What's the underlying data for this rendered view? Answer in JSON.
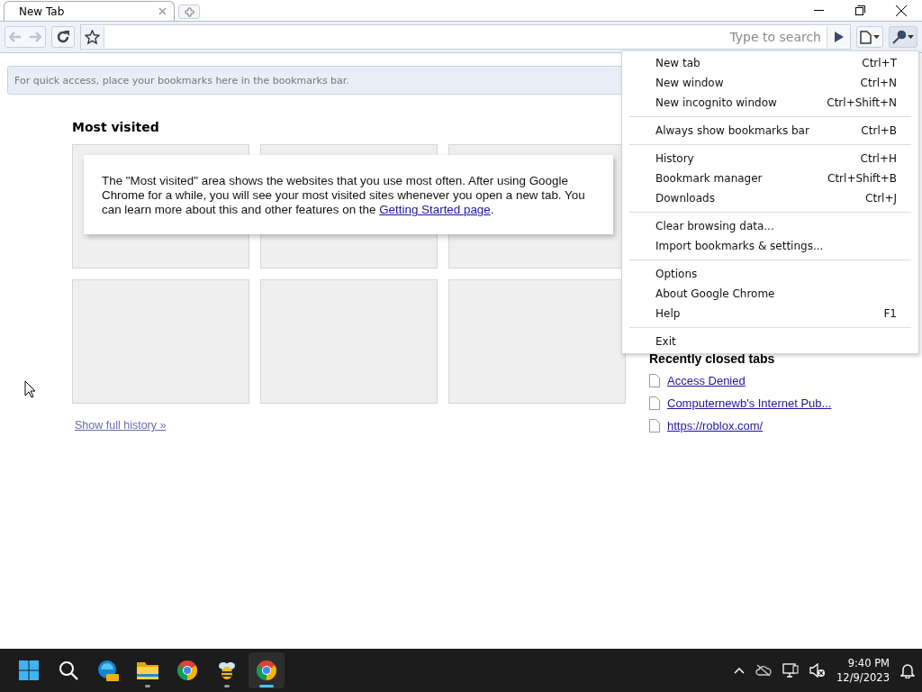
{
  "tabs": [
    {
      "title": "New Tab",
      "selected": true
    }
  ],
  "toolbar": {
    "search_placeholder": "Type to search"
  },
  "bookmarks_bar": {
    "message": "For quick access, place your bookmarks here in the bookmarks bar."
  },
  "most_visited": {
    "title": "Most visited",
    "info": "The \"Most visited\" area shows the websites that you use most often. After using Google Chrome for a while, you will see your most visited sites whenever you open a new tab. You can learn more about this and other features on the ",
    "info_link": "Getting Started page",
    "info_end": ".",
    "history_link": "Show full history »"
  },
  "recently_closed": {
    "title": "Recently closed tabs",
    "items": [
      "Access Denied",
      "Computernewb's Internet Pub...",
      "https://roblox.com/"
    ]
  },
  "menu": {
    "groups": [
      [
        {
          "label": "New tab",
          "shortcut": "Ctrl+T"
        },
        {
          "label": "New window",
          "shortcut": "Ctrl+N"
        },
        {
          "label": "New incognito window",
          "shortcut": "Ctrl+Shift+N"
        }
      ],
      [
        {
          "label": "Always show bookmarks bar",
          "shortcut": "Ctrl+B"
        }
      ],
      [
        {
          "label": "History",
          "shortcut": "Ctrl+H"
        },
        {
          "label": "Bookmark manager",
          "shortcut": "Ctrl+Shift+B"
        },
        {
          "label": "Downloads",
          "shortcut": "Ctrl+J"
        }
      ],
      [
        {
          "label": "Clear browsing data..."
        },
        {
          "label": "Import bookmarks & settings..."
        }
      ],
      [
        {
          "label": "Options"
        },
        {
          "label": "About Google Chrome"
        },
        {
          "label": "Help",
          "shortcut": "F1"
        }
      ],
      [
        {
          "label": "Exit"
        }
      ]
    ]
  },
  "taskbar": {
    "apps": [
      {
        "kind": "start",
        "running": false,
        "active": false
      },
      {
        "kind": "search",
        "running": false,
        "active": false
      },
      {
        "kind": "edge",
        "running": false,
        "active": false
      },
      {
        "kind": "folder",
        "running": true,
        "active": false
      },
      {
        "kind": "chrome",
        "running": false,
        "active": false
      },
      {
        "kind": "bee",
        "running": true,
        "active": false
      },
      {
        "kind": "chrome",
        "running": true,
        "active": true
      }
    ],
    "time": "9:40 PM",
    "date": "12/9/2023"
  }
}
